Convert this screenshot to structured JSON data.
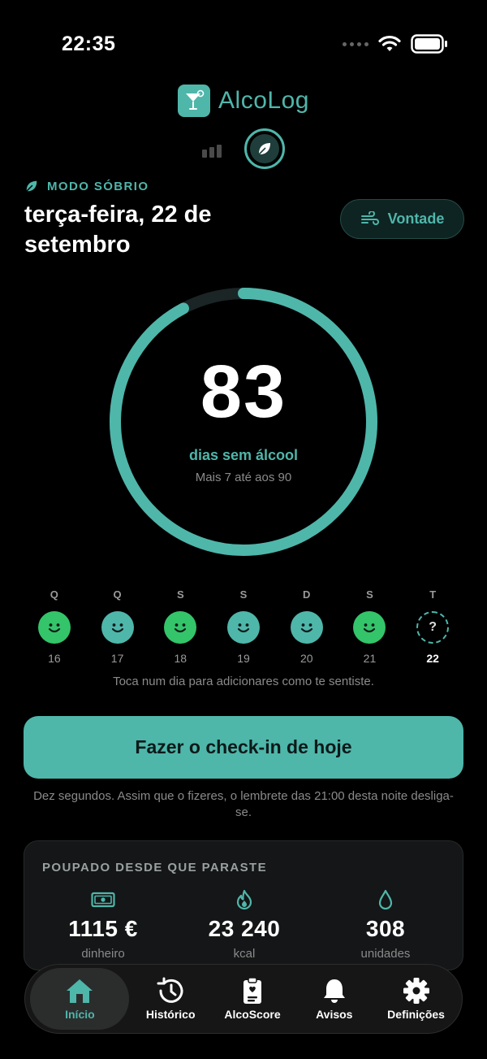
{
  "status_bar": {
    "time": "22:35"
  },
  "brand": {
    "name": "AlcoLog",
    "accent": "#4fb6aa"
  },
  "mode": {
    "label": "MODO SÓBRIO"
  },
  "header": {
    "date": "terça-feira, 22 de setembro",
    "urge_button": "Vontade"
  },
  "streak": {
    "days": "83",
    "unit": "dias sem álcool",
    "subtitle": "Mais 7 até aos 90",
    "progress": 0.922
  },
  "week": {
    "days": [
      {
        "letter": "Q",
        "number": "16",
        "mood": "green"
      },
      {
        "letter": "Q",
        "number": "17",
        "mood": "teal"
      },
      {
        "letter": "S",
        "number": "18",
        "mood": "green"
      },
      {
        "letter": "S",
        "number": "19",
        "mood": "teal"
      },
      {
        "letter": "D",
        "number": "20",
        "mood": "teal"
      },
      {
        "letter": "S",
        "number": "21",
        "mood": "green"
      },
      {
        "letter": "T",
        "number": "22",
        "mood": "unknown",
        "symbol": "?"
      }
    ],
    "hint": "Toca num dia para adicionares como te sentiste."
  },
  "checkin": {
    "label": "Fazer o check-in de hoje",
    "note": "Dez segundos. Assim que o fizeres, o lembrete das 21:00 desta noite desliga-se."
  },
  "savings": {
    "title": "POUPADO DESDE QUE PARASTE",
    "items": [
      {
        "icon": "money-icon",
        "value": "1115 €",
        "unit": "dinheiro"
      },
      {
        "icon": "flame-icon",
        "value": "23 240",
        "unit": "kcal"
      },
      {
        "icon": "drop-icon",
        "value": "308",
        "unit": "unidades"
      }
    ]
  },
  "tabs": [
    {
      "icon": "home-icon",
      "label": "Início",
      "active": true
    },
    {
      "icon": "history-icon",
      "label": "Histórico"
    },
    {
      "icon": "clipboard-icon",
      "label": "AlcoScore"
    },
    {
      "icon": "bell-icon",
      "label": "Avisos"
    },
    {
      "icon": "gear-icon",
      "label": "Definições"
    }
  ]
}
